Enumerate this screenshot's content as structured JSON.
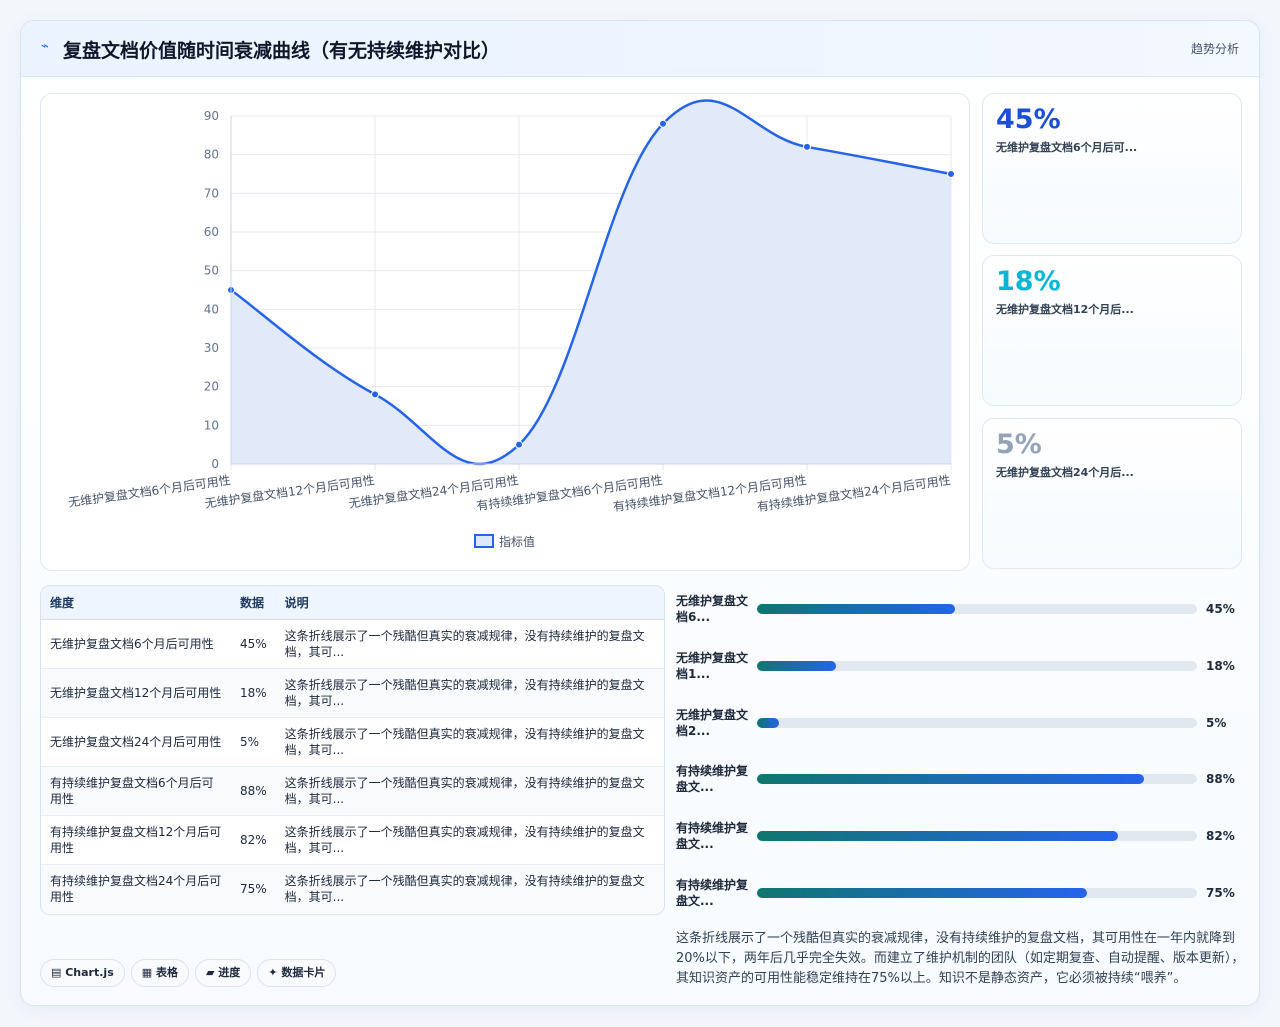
{
  "header": {
    "icon": "line-chart-icon",
    "title": "复盘文档价值随时间衰减曲线（有无持续维护对比）",
    "tag": "趋势分析"
  },
  "chart_data": {
    "type": "line",
    "categories": [
      "无维护复盘文档6个月后可用性",
      "无维护复盘文档12个月后可用性",
      "无维护复盘文档24个月后可用性",
      "有持续维护复盘文档6个月后可用性",
      "有持续维护复盘文档12个月后可用性",
      "有持续维护复盘文档24个月后可用性"
    ],
    "series": [
      {
        "name": "指标值",
        "values": [
          45,
          18,
          5,
          88,
          82,
          75
        ],
        "color": "#2563eb",
        "fill": "#dfe8fa"
      }
    ],
    "ylim": [
      0,
      90
    ],
    "yticks": [
      0,
      10,
      20,
      30,
      40,
      50,
      60,
      70,
      80,
      90
    ],
    "grid": true,
    "legend": "bottom"
  },
  "kpis": [
    {
      "value": "45%",
      "label": "无维护复盘文档6个月后可...",
      "color": "#1d4ed8"
    },
    {
      "value": "18%",
      "label": "无维护复盘文档12个月后...",
      "color": "#06b6d4"
    },
    {
      "value": "5%",
      "label": "无维护复盘文档24个月后...",
      "color": "#94a3b8"
    }
  ],
  "table": {
    "headers": [
      "维度",
      "数据",
      "说明"
    ],
    "rows": [
      {
        "dim": "无维护复盘文档6个月后可用性",
        "val": "45%",
        "desc": "这条折线展示了一个残酷但真实的衰减规律，没有持续维护的复盘文档，其可..."
      },
      {
        "dim": "无维护复盘文档12个月后可用性",
        "val": "18%",
        "desc": "这条折线展示了一个残酷但真实的衰减规律，没有持续维护的复盘文档，其可..."
      },
      {
        "dim": "无维护复盘文档24个月后可用性",
        "val": "5%",
        "desc": "这条折线展示了一个残酷但真实的衰减规律，没有持续维护的复盘文档，其可..."
      },
      {
        "dim": "有持续维护复盘文档6个月后可用性",
        "val": "88%",
        "desc": "这条折线展示了一个残酷但真实的衰减规律，没有持续维护的复盘文档，其可..."
      },
      {
        "dim": "有持续维护复盘文档12个月后可用性",
        "val": "82%",
        "desc": "这条折线展示了一个残酷但真实的衰减规律，没有持续维护的复盘文档，其可..."
      },
      {
        "dim": "有持续维护复盘文档24个月后可用性",
        "val": "75%",
        "desc": "这条折线展示了一个残酷但真实的衰减规律，没有持续维护的复盘文档，其可..."
      }
    ]
  },
  "progress": [
    {
      "label": "无维护复盘文档6...",
      "value": 45,
      "pct": "45%"
    },
    {
      "label": "无维护复盘文档1...",
      "value": 18,
      "pct": "18%"
    },
    {
      "label": "无维护复盘文档2...",
      "value": 5,
      "pct": "5%"
    },
    {
      "label": "有持续维护复盘文...",
      "value": 88,
      "pct": "88%"
    },
    {
      "label": "有持续维护复盘文...",
      "value": 82,
      "pct": "82%"
    },
    {
      "label": "有持续维护复盘文...",
      "value": 75,
      "pct": "75%"
    }
  ],
  "summary": "这条折线展示了一个残酷但真实的衰减规律，没有持续维护的复盘文档，其可用性在一年内就降到20%以下，两年后几乎完全失效。而建立了维护机制的团队（如定期复查、自动提醒、版本更新），其知识资产的可用性能稳定维持在75%以上。知识不是静态资产，它必须被持续“喂养”。",
  "chips": [
    {
      "icon": "chart-icon",
      "glyph": "▤",
      "label": "Chart.js"
    },
    {
      "icon": "table-icon",
      "glyph": "▦",
      "label": "表格"
    },
    {
      "icon": "progress-icon",
      "glyph": "▰",
      "label": "进度"
    },
    {
      "icon": "sparkle-icon",
      "glyph": "✦",
      "label": "数据卡片"
    }
  ]
}
